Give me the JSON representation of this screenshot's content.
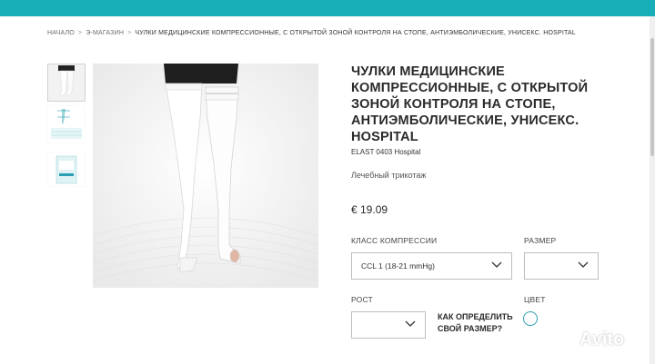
{
  "colors": {
    "topbar": "#17aeb8",
    "accent": "#2a9fb5"
  },
  "breadcrumb": {
    "items": [
      "НАЧАЛО",
      "Э-МАГАЗИН"
    ],
    "separator": ">",
    "current": "ЧУЛКИ МЕДИЦИНСКИЕ КОМПРЕССИОННЫЕ, С ОТКРЫТОЙ ЗОНОЙ КОНТРОЛЯ НА СТОПЕ, АНТИЭМБОЛИЧЕСКИЕ, УНИСЕКС. HOSPITAL"
  },
  "product": {
    "title": "ЧУЛКИ МЕДИЦИНСКИЕ КОМПРЕССИОННЫЕ, С ОТКРЫТОЙ ЗОНОЙ КОНТРОЛЯ НА СТОПЕ, АНТИЭМБОЛИЧЕСКИЕ, УНИСЕКС. HOSPITAL",
    "sku": "ELAST 0403 Hospital",
    "category": "Лечебный трикотаж",
    "price": "€ 19.09"
  },
  "options": {
    "compression_label": "КЛАСС КОМПРЕССИИ",
    "compression_value": "CCL 1 (18-21 mmHg)",
    "size_label": "РАЗМЕР",
    "size_value": "",
    "height_label": "РОСТ",
    "height_value": "",
    "size_help": "КАК ОПРЕДЕЛИТЬ СВОЙ РАЗМЕР?",
    "color_label": "ЦВЕТ"
  },
  "watermark": {
    "text": "Avito"
  }
}
